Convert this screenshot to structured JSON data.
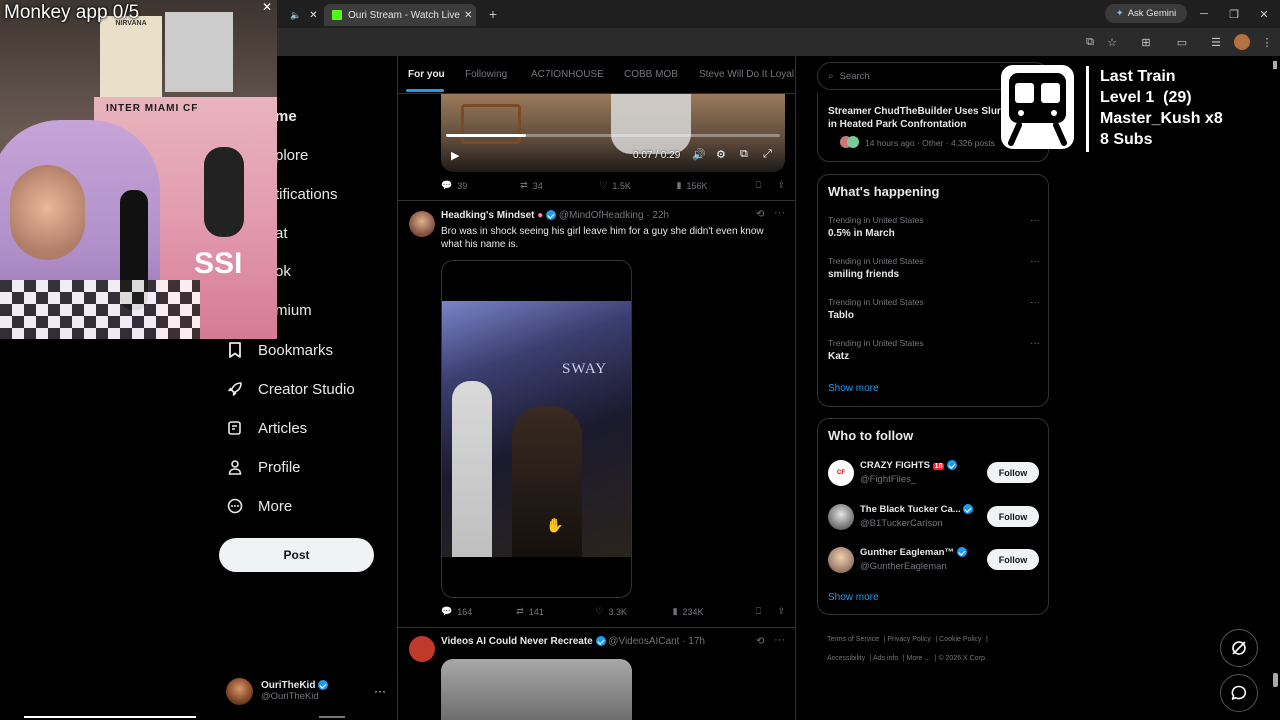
{
  "browser": {
    "tab_title": "Ouri Stream - Watch Live on Kic",
    "ask_gemini": "Ask Gemini"
  },
  "stream_overlay": {
    "monkey_app": "Monkey app 0/5",
    "goal_title": "Last Train",
    "goal_level": "Level 1  (29)",
    "goal_user": "Master_Kush x8",
    "goal_subs": "8 Subs",
    "poster_text_1": "INTER MIAMI CF",
    "poster_text_2": "NIRVANA",
    "poster_text_3": "SSI"
  },
  "sidebar": {
    "items": [
      {
        "label": "me",
        "icon": "home-icon"
      },
      {
        "label": "plore",
        "icon": "explore-icon"
      },
      {
        "label": "tifications",
        "icon": "notifications-icon"
      },
      {
        "label": "at",
        "icon": "chat-icon"
      },
      {
        "label": "ok",
        "icon": "grok-icon"
      },
      {
        "label": "mium",
        "icon": "premium-icon"
      },
      {
        "label": "Bookmarks",
        "icon": "bookmark-icon"
      },
      {
        "label": "Creator Studio",
        "icon": "rocket-icon"
      },
      {
        "label": "Articles",
        "icon": "article-icon"
      },
      {
        "label": "Profile",
        "icon": "profile-icon"
      },
      {
        "label": "More",
        "icon": "more-circle-icon"
      }
    ],
    "post_button": "Post",
    "account": {
      "name": "OuriTheKid",
      "handle": "@OuriTheKid"
    }
  },
  "feed": {
    "tabs": [
      "For you",
      "Following",
      "AC7IONHOUSE",
      "COBB MOB",
      "Steve Will Do It Loyal"
    ],
    "video1": {
      "time": "0:07 / 0:29",
      "progress": 0.24
    },
    "post1_actions": {
      "replies": "39",
      "reposts": "34",
      "likes": "1.5K",
      "views": "156K"
    },
    "post2": {
      "name": "Headking's Mindset",
      "handle": "@MindOfHeadking · 22h",
      "text": "Bro was in shock seeing his girl leave him for a guy she didn't even know what his name is.",
      "sign": "SWAY",
      "actions": {
        "replies": "164",
        "reposts": "141",
        "likes": "3.3K",
        "views": "234K"
      }
    },
    "post3": {
      "name": "Videos AI Could Never Recreate",
      "handle": "@VideosAICant · 17h"
    }
  },
  "right": {
    "search_placeholder": "Search",
    "live": {
      "title": "Streamer ChudTheBuilder Uses Slur in Heated Park Confrontation",
      "meta": "14 hours ago · Other · 4,326 posts"
    },
    "happening_title": "What's happening",
    "trends": [
      {
        "meta": "Trending in United States",
        "name": "0.5% in March"
      },
      {
        "meta": "Trending in United States",
        "name": "smiling friends"
      },
      {
        "meta": "Trending in United States",
        "name": "Tablo"
      },
      {
        "meta": "Trending in United States",
        "name": "Katz"
      }
    ],
    "show_more": "Show more",
    "who_title": "Who to follow",
    "follow_label": "Follow",
    "who": [
      {
        "name": "CRAZY FIGHTS",
        "badge": "18",
        "handle": "@FightFiles_"
      },
      {
        "name": "The Black Tucker Ca...",
        "handle": "@B1TuckerCarlson"
      },
      {
        "name": "Gunther Eagleman™",
        "handle": "@GuntherEagleman"
      }
    ],
    "footer": {
      "terms": "Terms of Service",
      "privacy": "Privacy Policy",
      "cookie": "Cookie Policy",
      "accessibility": "Accessibility",
      "ads": "Ads info",
      "more": "More ...",
      "copyright": "© 2026 X Corp."
    }
  },
  "colors": {
    "accent": "#1d9bf0",
    "background": "#000000",
    "border": "#2f3336",
    "muted": "#71767b"
  }
}
